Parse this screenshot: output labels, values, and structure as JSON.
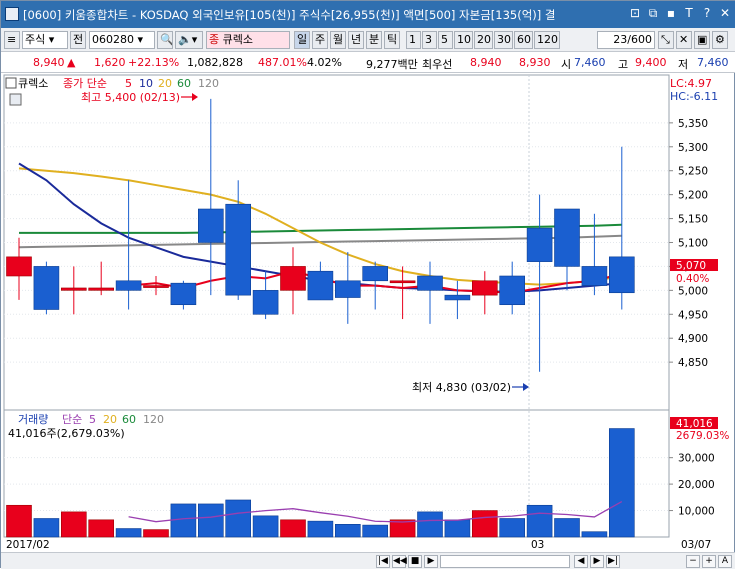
{
  "window": {
    "title": "[0600] 키움종합차트 - KOSDAQ 외국인보유[105(천)] 주식수[26,955(천)] 액면[500] 자본금[135(억)] 결",
    "buttons": [
      "⊡",
      "⧉",
      "▪",
      "T",
      "?",
      "✕"
    ]
  },
  "toolbar": {
    "type_label": "주식",
    "prev_label": "전",
    "code_value": "060280",
    "name_value": "큐렉소",
    "period_buttons": [
      "일",
      "주",
      "월",
      "년",
      "분",
      "틱"
    ],
    "interval_buttons": [
      "1",
      "3",
      "5",
      "10",
      "20",
      "30",
      "60",
      "120"
    ],
    "page_counter": "23/600"
  },
  "quote": {
    "price": "8,940",
    "change_arrow": "▲",
    "change": "1,620",
    "change_pct": "+22.13%",
    "volume": "1,082,828",
    "volume_ratio": "487.01%",
    "turnover": "4.02%",
    "amount": "9,277백만",
    "best_label": "최우선",
    "ask": "8,940",
    "bid": "8,930",
    "open_label": "시",
    "open": "7,460",
    "high_label": "고",
    "high": "9,400",
    "low_label": "저",
    "low": "7,460"
  },
  "price_panel": {
    "legend_name": "큐렉소",
    "legend_ma": "종가 단순",
    "ma_periods": [
      "5",
      "10",
      "20",
      "60",
      "120"
    ],
    "ma_colors": [
      "#e8001c",
      "#1a2a9a",
      "#e0b020",
      "#1a8a3a",
      "#888888"
    ],
    "lc": "LC:4.97",
    "hc": "HC:-6.11",
    "high_marker": "최고 5,400 (02/13)",
    "low_marker": "최저 4,830 (03/02)",
    "current_price_tag": "5,070",
    "current_pct_tag": "0.40%"
  },
  "volume_panel": {
    "legend_name": "거래량",
    "legend_ma": "단순",
    "ma_periods": [
      "5",
      "20",
      "60",
      "120"
    ],
    "ma_colors": [
      "#9a3fb0",
      "#e0b020",
      "#1a8a3a",
      "#888888"
    ],
    "current_value": "41,016주(2,679.03%)",
    "tag_value": "41,016",
    "tag_pct": "2679.03%"
  },
  "x_axis": {
    "labels": [
      "2017/02",
      "03",
      "03/07"
    ]
  },
  "chart_data": {
    "type": "candlestick",
    "price_ylim": [
      4750,
      5450
    ],
    "price_ticks": [
      4850,
      4900,
      4950,
      5000,
      5050,
      5100,
      5150,
      5200,
      5250,
      5300,
      5350
    ],
    "candles": [
      {
        "o": 5030,
        "h": 5110,
        "l": 4980,
        "c": 5070
      },
      {
        "o": 5050,
        "h": 5060,
        "l": 4950,
        "c": 4960
      },
      {
        "o": 5000,
        "h": 5050,
        "l": 4950,
        "c": 5005
      },
      {
        "o": 5000,
        "h": 5060,
        "l": 4990,
        "c": 5005
      },
      {
        "o": 5020,
        "h": 5230,
        "l": 4960,
        "c": 5000
      },
      {
        "o": 5010,
        "h": 5030,
        "l": 4990,
        "c": 5010
      },
      {
        "o": 5015,
        "h": 5020,
        "l": 4960,
        "c": 4970
      },
      {
        "o": 5170,
        "h": 5400,
        "l": 4990,
        "c": 5100
      },
      {
        "o": 5180,
        "h": 5230,
        "l": 4980,
        "c": 4990
      },
      {
        "o": 5000,
        "h": 5040,
        "l": 4940,
        "c": 4950
      },
      {
        "o": 5000,
        "h": 5090,
        "l": 4950,
        "c": 5050
      },
      {
        "o": 5040,
        "h": 5060,
        "l": 4980,
        "c": 4980
      },
      {
        "o": 5020,
        "h": 5080,
        "l": 4930,
        "c": 4985
      },
      {
        "o": 5050,
        "h": 5060,
        "l": 4960,
        "c": 5020
      },
      {
        "o": 5020,
        "h": 5050,
        "l": 4940,
        "c": 5020
      },
      {
        "o": 5030,
        "h": 5060,
        "l": 4930,
        "c": 5000
      },
      {
        "o": 4990,
        "h": 5020,
        "l": 4940,
        "c": 4980
      },
      {
        "o": 4990,
        "h": 5040,
        "l": 4950,
        "c": 5020
      },
      {
        "o": 5030,
        "h": 5060,
        "l": 4950,
        "c": 4970
      },
      {
        "o": 5130,
        "h": 5200,
        "l": 4830,
        "c": 5060
      },
      {
        "o": 5170,
        "h": 5170,
        "l": 5000,
        "c": 5050
      },
      {
        "o": 5050,
        "h": 5160,
        "l": 4990,
        "c": 5010
      },
      {
        "o": 5070,
        "h": 5300,
        "l": 4960,
        "c": 4995
      }
    ],
    "ma5": [
      null,
      null,
      null,
      null,
      5010,
      5015,
      5005,
      5020,
      5030,
      5025,
      5040,
      5025,
      5010,
      5010,
      5005,
      5010,
      5000,
      4998,
      4995,
      5005,
      5015,
      5020,
      5035
    ],
    "ma10": [
      5265,
      5230,
      5180,
      5140,
      5110,
      5090,
      5070,
      5060,
      5050,
      5040,
      5030,
      5020,
      5015,
      5010,
      5005,
      5003,
      5000,
      4998,
      4997,
      5000,
      5005,
      5010,
      5015
    ],
    "ma20": [
      5255,
      5250,
      5245,
      5238,
      5230,
      5220,
      5210,
      5200,
      5185,
      5160,
      5130,
      5100,
      5075,
      5055,
      5040,
      5030,
      5022,
      5018,
      5015,
      5012,
      5015,
      5020,
      5030
    ],
    "ma60": [
      5120,
      5120,
      5120,
      5120,
      5120,
      5120,
      5120,
      5121,
      5122,
      5123,
      5124,
      5125,
      5126,
      5127,
      5128,
      5129,
      5130,
      5131,
      5132,
      5133,
      5134,
      5135,
      5137
    ],
    "ma120": [
      5090,
      5091,
      5092,
      5093,
      5094,
      5095,
      5096,
      5097,
      5098,
      5099,
      5100,
      5101,
      5102,
      5103,
      5104,
      5105,
      5106,
      5107,
      5108,
      5109,
      5110,
      5112,
      5114
    ],
    "volume_ylim": [
      0,
      45000
    ],
    "volume_ticks": [
      10000,
      20000,
      30000
    ],
    "volumes": [
      12000,
      7000,
      9500,
      6500,
      3200,
      2800,
      12500,
      12500,
      14000,
      8000,
      6500,
      6000,
      4800,
      4500,
      6500,
      9500,
      6500,
      10000,
      7000,
      12000,
      7000,
      2000,
      41016
    ],
    "vol_ma5": [
      null,
      null,
      null,
      null,
      7640,
      5800,
      6900,
      7500,
      9000,
      9960,
      10700,
      9200,
      7860,
      5960,
      5660,
      6260,
      6360,
      7400,
      7900,
      9000,
      8500,
      7600,
      13400
    ]
  }
}
